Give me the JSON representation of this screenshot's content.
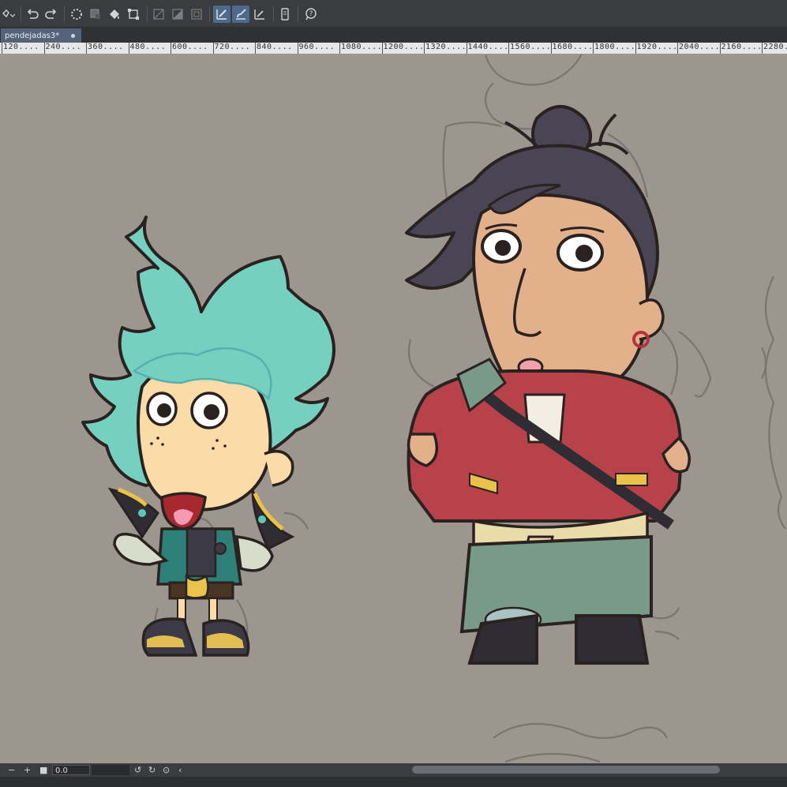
{
  "document": {
    "tab_title": "pendejadas3*"
  },
  "toolbar": {
    "icons": [
      "layer-menu-icon",
      "undo-icon",
      "redo-icon",
      "loading-icon",
      "selection-icon",
      "fill-icon",
      "transform-icon",
      "snap-off-icon",
      "snap-ruler-icon",
      "snap-grid-icon",
      "pen-icon",
      "brush-icon",
      "ruler-icon",
      "phone-icon",
      "help-icon"
    ]
  },
  "ruler": {
    "labels": [
      "120",
      "240",
      "360",
      "480",
      "600",
      "720",
      "840",
      "960",
      "1080",
      "1200",
      "1320",
      "1440",
      "1560",
      "1680",
      "1800",
      "1920",
      "2040",
      "2160",
      "2280"
    ]
  },
  "status": {
    "zoom_value": "0.0"
  },
  "colors": {
    "canvas": "#9c968e",
    "toolbar": "#3a3c40",
    "tab_active": "#55637a"
  }
}
